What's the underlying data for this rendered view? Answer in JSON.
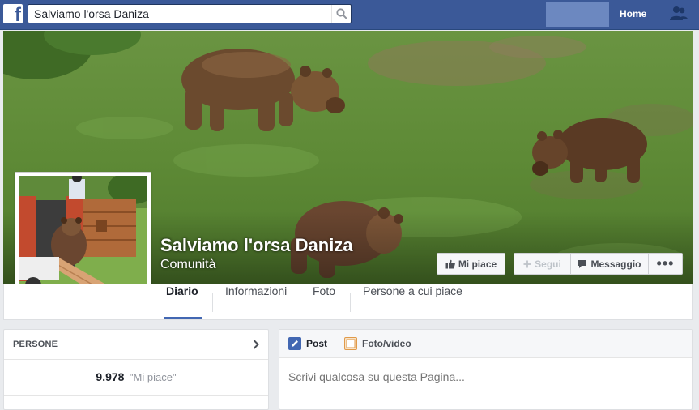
{
  "topbar": {
    "search_value": "Salviamo l'orsa Daniza",
    "home_label": "Home",
    "logo_letter": "f",
    "icons": [
      "facebook-logo-icon",
      "search-icon",
      "friend-requests-icon"
    ]
  },
  "page": {
    "name": "Salviamo l'orsa Daniza",
    "category": "Comunità"
  },
  "actions": {
    "like_label": "Mi piace",
    "follow_label": "Segui",
    "message_label": "Messaggio",
    "more_label": "•••"
  },
  "nav": {
    "tabs": [
      {
        "label": "Diario",
        "active": true
      },
      {
        "label": "Informazioni"
      },
      {
        "label": "Foto"
      },
      {
        "label": "Persone a cui piace"
      }
    ]
  },
  "people": {
    "title": "PERSONE",
    "likes_count": "9.978",
    "likes_label": "\"Mi piace\""
  },
  "composer": {
    "tabs": [
      {
        "label": "Post"
      },
      {
        "label": "Foto/video"
      }
    ],
    "placeholder": "Scrivi qualcosa su questa Pagina..."
  },
  "colors": {
    "topbar": "#3b5998",
    "accent": "#4267b2",
    "page_bg": "#e9ebee"
  }
}
